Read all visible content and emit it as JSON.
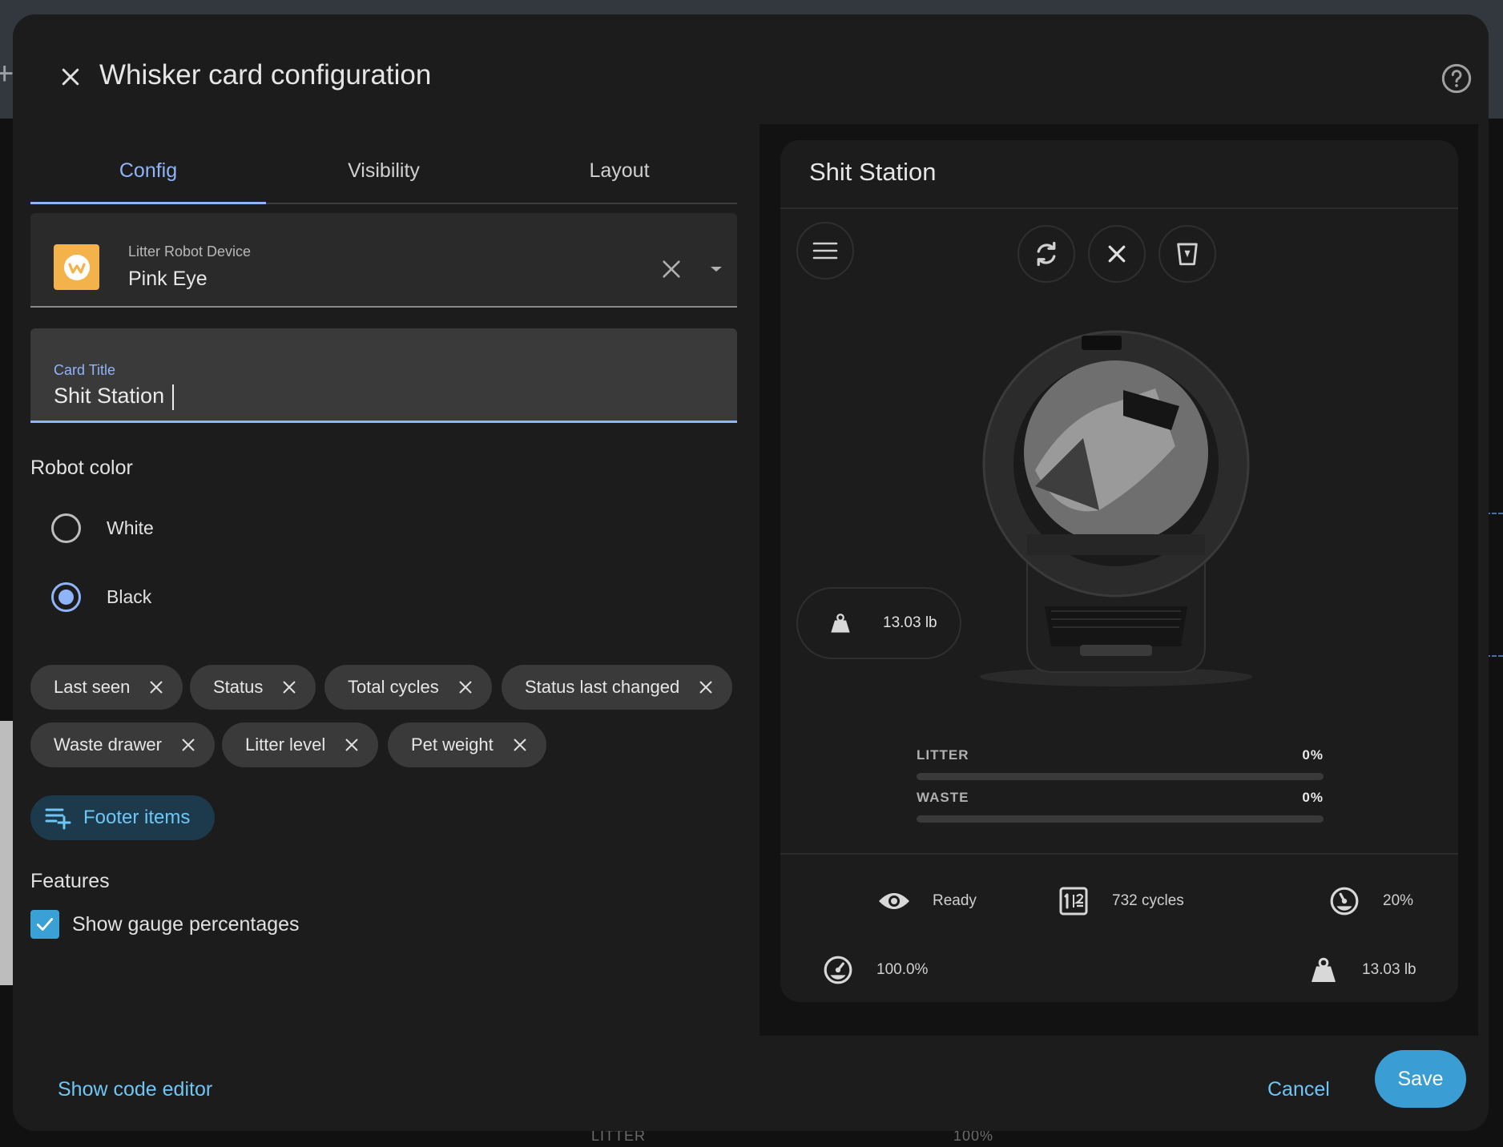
{
  "dialog": {
    "title": "Whisker card configuration"
  },
  "tabs": [
    {
      "label": "Config",
      "active": true
    },
    {
      "label": "Visibility",
      "active": false
    },
    {
      "label": "Layout",
      "active": false
    }
  ],
  "device_picker": {
    "label": "Litter Robot Device",
    "value": "Pink Eye"
  },
  "card_title_field": {
    "label": "Card Title",
    "value": "Shit Station"
  },
  "robot_color": {
    "label": "Robot color",
    "options": [
      {
        "label": "White",
        "checked": false
      },
      {
        "label": "Black",
        "checked": true
      }
    ]
  },
  "footer_chips": [
    "Last seen",
    "Status",
    "Total cycles",
    "Status last changed",
    "Waste drawer",
    "Litter level",
    "Pet weight"
  ],
  "footer_button": {
    "label": "Footer items"
  },
  "features": {
    "label": "Features",
    "show_gauge_percentages": {
      "label": "Show gauge percentages",
      "checked": true
    }
  },
  "actions": {
    "code_editor": "Show code editor",
    "cancel": "Cancel",
    "save": "Save"
  },
  "preview": {
    "card_title": "Shit Station",
    "weight_pill": "13.03 lb",
    "gauges": [
      {
        "name": "LITTER",
        "percent": "0%",
        "fill": 0
      },
      {
        "name": "WASTE",
        "percent": "0%",
        "fill": 0
      }
    ],
    "stats": {
      "status": "Ready",
      "cycles": "732 cycles",
      "waste_level": "20%",
      "litter_level": "100.0%",
      "pet_weight": "13.03 lb"
    }
  },
  "background": {
    "litter_label": "LITTER",
    "litter_value": "100%"
  },
  "colors": {
    "accent": "#8fb4f8",
    "link": "#6ec6f5",
    "save_button": "#3a9dd3",
    "dialog_bg": "#1c1c1c",
    "logo": "#f4b24a"
  }
}
